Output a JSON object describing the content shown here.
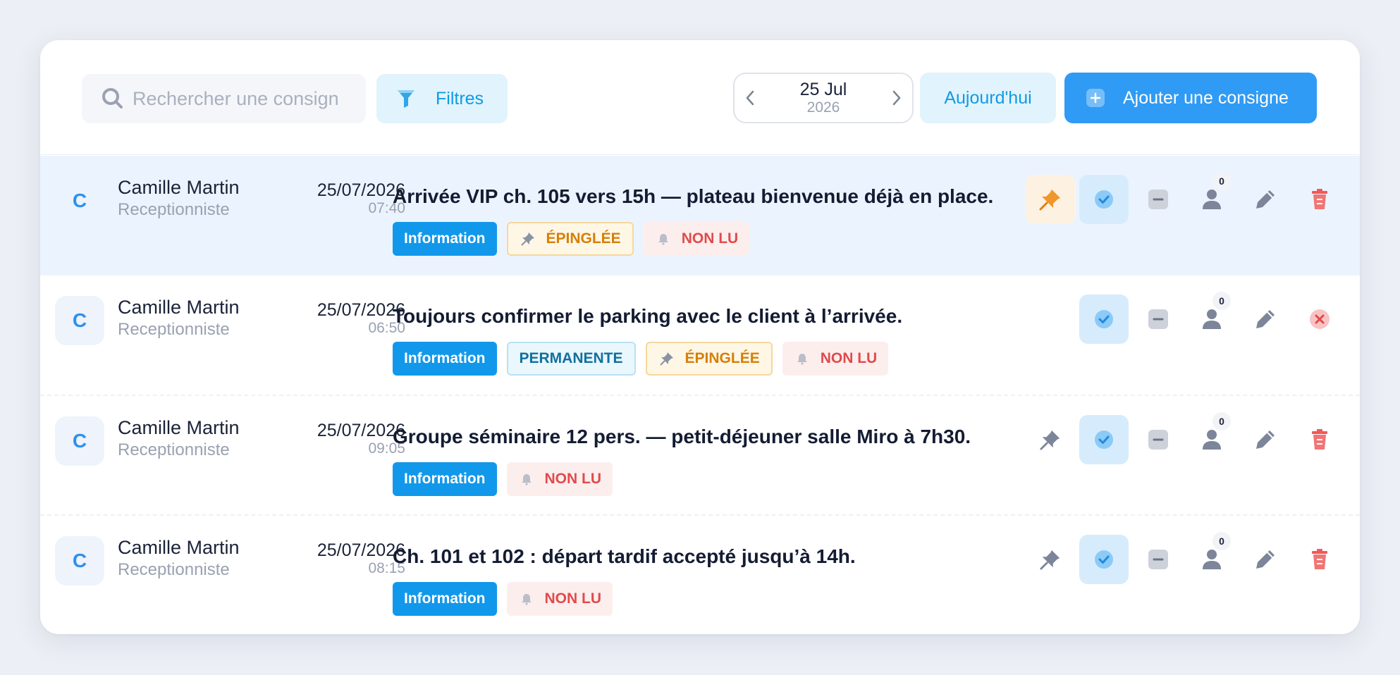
{
  "toolbar": {
    "search_placeholder": "Rechercher une consign",
    "filters_label": "Filtres",
    "date_day": "25 Jul",
    "date_year": "2026",
    "today_label": "Aujourd'hui",
    "add_label": "Ajouter une consigne"
  },
  "colors": {
    "accent": "#2f9bf5",
    "info_tag": "#1198eb",
    "pinned": "#d67f08",
    "unread": "#e04b4b",
    "highlight_row": "#ebf4fe"
  },
  "rows": [
    {
      "avatar": "C",
      "name": "Camille Martin",
      "role": "Receptionniste",
      "date": "25/07/2026",
      "time": "07:40",
      "message": "Arrivée VIP ch. 105 vers 15h — plateau bienvenue déjà en place.",
      "tags": {
        "info": "Information",
        "pinned": "ÉPINGLÉE",
        "unread": "NON LU"
      },
      "reads": "0",
      "pinned": true,
      "delete_icon": "trash-icon"
    },
    {
      "avatar": "C",
      "name": "Camille Martin",
      "role": "Receptionniste",
      "date": "25/07/2026",
      "time": "06:50",
      "message": "Toujours confirmer le parking avec le client à l’arrivée.",
      "tags": {
        "info": "Information",
        "permanent": "PERMANENTE",
        "pinned": "ÉPINGLÉE",
        "unread": "NON LU"
      },
      "reads": "0",
      "pinned": true,
      "delete_icon": "close-circle-icon"
    },
    {
      "avatar": "C",
      "name": "Camille Martin",
      "role": "Receptionniste",
      "date": "25/07/2026",
      "time": "09:05",
      "message": "Groupe séminaire 12 pers. — petit-déjeuner salle Miro à 7h30.",
      "tags": {
        "info": "Information",
        "unread": "NON LU"
      },
      "reads": "0",
      "pinned": false,
      "delete_icon": "trash-icon"
    },
    {
      "avatar": "C",
      "name": "Camille Martin",
      "role": "Receptionniste",
      "date": "25/07/2026",
      "time": "08:15",
      "message": "Ch. 101 et 102 : départ tardif accepté jusqu’à 14h.",
      "tags": {
        "info": "Information",
        "unread": "NON LU"
      },
      "reads": "0",
      "pinned": false,
      "delete_icon": "trash-icon"
    }
  ]
}
